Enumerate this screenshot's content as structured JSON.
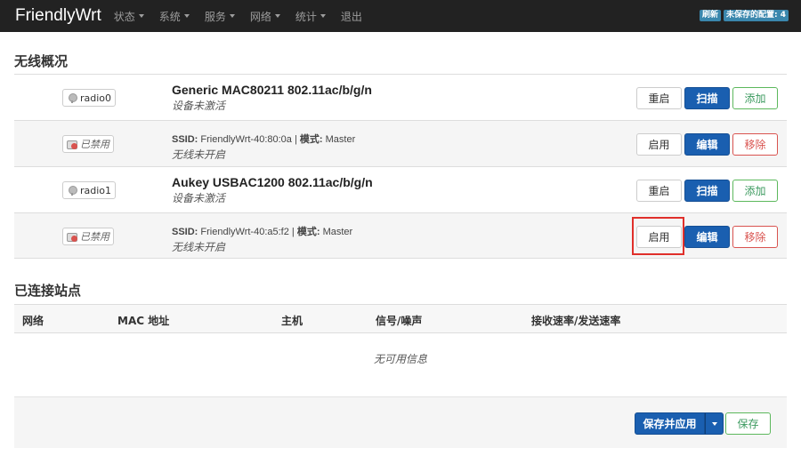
{
  "navbar": {
    "brand": "FriendlyWrt",
    "items": [
      "状态",
      "系统",
      "服务",
      "网络",
      "统计",
      "退出"
    ],
    "badges": {
      "refresh": "刷新",
      "unsaved": "未保存的配置: 4"
    }
  },
  "wireless": {
    "heading": "无线概况",
    "rows": [
      {
        "badge": "radio0",
        "title": "Generic MAC80211 802.11ac/b/g/n",
        "sub": "设备未激活",
        "buttons": [
          "重启",
          "扫描",
          "添加"
        ]
      },
      {
        "badge": "已禁用",
        "ssid_label": "SSID:",
        "ssid": "FriendlyWrt-40:80:0a",
        "sep": "|",
        "mode_label": "模式:",
        "mode": "Master",
        "sub": "无线未开启",
        "buttons": [
          "启用",
          "编辑",
          "移除"
        ]
      },
      {
        "badge": "radio1",
        "title": "Aukey USBAC1200 802.11ac/b/g/n",
        "sub": "设备未激活",
        "buttons": [
          "重启",
          "扫描",
          "添加"
        ]
      },
      {
        "badge": "已禁用",
        "ssid_label": "SSID:",
        "ssid": "FriendlyWrt-40:a5:f2",
        "sep": "|",
        "mode_label": "模式:",
        "mode": "Master",
        "sub": "无线未开启",
        "buttons": [
          "启用",
          "编辑",
          "移除"
        ]
      }
    ]
  },
  "stations": {
    "heading": "已连接站点",
    "columns": [
      "网络",
      "MAC 地址",
      "主机",
      "信号/噪声",
      "接收速率/发送速率"
    ],
    "empty": "无可用信息"
  },
  "footer": {
    "save_apply": "保存并应用",
    "save": "保存"
  }
}
